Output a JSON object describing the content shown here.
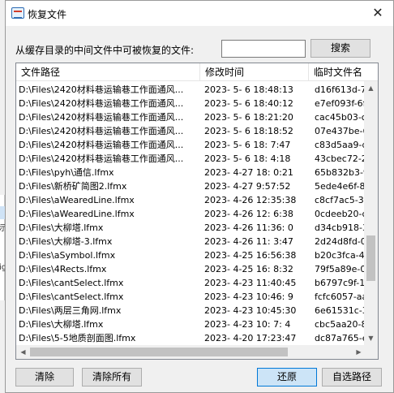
{
  "dialog": {
    "title": "恢复文件",
    "close_glyph": "✕",
    "search_label": "从缓存目录的中间文件中可被恢复的文件:",
    "search_value": "",
    "search_button": "搜索"
  },
  "columns": [
    "文件路径",
    "修改时间",
    "临时文件名"
  ],
  "files": [
    {
      "path": "D:\\Files\\2420材料巷运输巷工作面通风...",
      "time": "2023- 5- 6 18:48:13",
      "tmp": "d16f613d-77fe"
    },
    {
      "path": "D:\\Files\\2420材料巷运输巷工作面通风...",
      "time": "2023- 5- 6 18:40:12",
      "tmp": "e7ef093f-6f0f"
    },
    {
      "path": "D:\\Files\\2420材料巷运输巷工作面通风...",
      "time": "2023- 5- 6 18:21:20",
      "tmp": "cac45b03-c1ca"
    },
    {
      "path": "D:\\Files\\2420材料巷运输巷工作面通风...",
      "time": "2023- 5- 6 18:18:52",
      "tmp": "07e437be-6b2"
    },
    {
      "path": "D:\\Files\\2420材料巷运输巷工作面通风...",
      "time": "2023- 5- 6 18: 7:47",
      "tmp": "c83d5aa9-d38"
    },
    {
      "path": "D:\\Files\\2420材料巷运输巷工作面通风...",
      "time": "2023- 5- 6 18: 4:18",
      "tmp": "43cbec72-246"
    },
    {
      "path": "D:\\Files\\pyh\\通信.lfmx",
      "time": "2023- 4-27 18: 0:21",
      "tmp": "65b832b3-93c"
    },
    {
      "path": "D:\\Files\\新桥矿简图2.lfmx",
      "time": "2023- 4-27 9:57:52",
      "tmp": "5ede4e6f-8a6"
    },
    {
      "path": "D:\\Files\\aWearedLine.lfmx",
      "time": "2023- 4-26 12:35:38",
      "tmp": "c8cf7ac5-36c2"
    },
    {
      "path": "D:\\Files\\aWearedLine.lfmx",
      "time": "2023- 4-26 12: 6:38",
      "tmp": "0cdeeb20-c80"
    },
    {
      "path": "D:\\Files\\大柳塔.lfmx",
      "time": "2023- 4-26 11:36: 0",
      "tmp": "d34cb918-37e"
    },
    {
      "path": "D:\\Files\\大柳塔-3.lfmx",
      "time": "2023- 4-26 11: 3:47",
      "tmp": "2d24d8fd-0ac"
    },
    {
      "path": "D:\\Files\\aSymbol.lfmx",
      "time": "2023- 4-25 16:56:38",
      "tmp": "b20c3fca-4bef"
    },
    {
      "path": "D:\\Files\\4Rects.lfmx",
      "time": "2023- 4-25 16: 8:32",
      "tmp": "79f5a89e-01f0"
    },
    {
      "path": "D:\\Files\\cantSelect.lfmx",
      "time": "2023- 4-23 11:40:45",
      "tmp": "b6797c9f-12b"
    },
    {
      "path": "D:\\Files\\cantSelect.lfmx",
      "time": "2023- 4-23 10:46: 9",
      "tmp": "fcfc6057-aa75"
    },
    {
      "path": "D:\\Files\\两层三角网.lfmx",
      "time": "2023- 4-23 10:45:30",
      "tmp": "6e61531c-37e"
    },
    {
      "path": "D:\\Files\\大柳塔.lfmx",
      "time": "2023- 4-23 10: 7: 4",
      "tmp": "cbc5aa20-8f70"
    },
    {
      "path": "D:\\Files\\5-5地质剖面图.lfmx",
      "time": "2023- 4-20 17:23:47",
      "tmp": "dc87a765-ed6"
    }
  ],
  "buttons": {
    "clear": "清除",
    "clear_all": "清除所有",
    "restore": "还原",
    "choose_path": "自选路径"
  },
  "background": {
    "glyphs": [
      "示",
      "ig"
    ]
  }
}
